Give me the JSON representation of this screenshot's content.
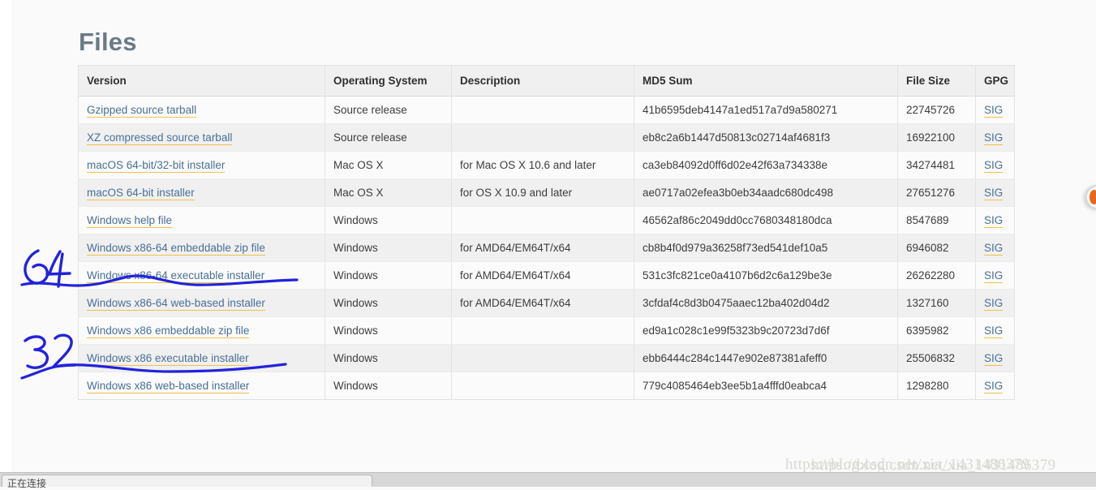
{
  "page": {
    "title": "Files",
    "background_color": "#fafafa",
    "link_color": "#4a6f96",
    "link_underline_color": "#f2c14a",
    "title_color": "#6b7a86"
  },
  "table": {
    "headers": [
      "Version",
      "Operating System",
      "Description",
      "MD5 Sum",
      "File Size",
      "GPG"
    ],
    "rows": [
      {
        "version": "Gzipped source tarball",
        "os": "Source release",
        "description": "",
        "md5": "41b6595deb4147a1ed517a7d9a580271",
        "size": "22745726",
        "gpg": "SIG"
      },
      {
        "version": "XZ compressed source tarball",
        "os": "Source release",
        "description": "",
        "md5": "eb8c2a6b1447d50813c02714af4681f3",
        "size": "16922100",
        "gpg": "SIG"
      },
      {
        "version": "macOS 64-bit/32-bit installer",
        "os": "Mac OS X",
        "description": "for Mac OS X 10.6 and later",
        "md5": "ca3eb84092d0ff6d02e42f63a734338e",
        "size": "34274481",
        "gpg": "SIG"
      },
      {
        "version": "macOS 64-bit installer",
        "os": "Mac OS X",
        "description": "for OS X 10.9 and later",
        "md5": "ae0717a02efea3b0eb34aadc680dc498",
        "size": "27651276",
        "gpg": "SIG"
      },
      {
        "version": "Windows help file",
        "os": "Windows",
        "description": "",
        "md5": "46562af86c2049dd0cc7680348180dca",
        "size": "8547689",
        "gpg": "SIG"
      },
      {
        "version": "Windows x86-64 embeddable zip file",
        "os": "Windows",
        "description": "for AMD64/EM64T/x64",
        "md5": "cb8b4f0d979a36258f73ed541def10a5",
        "size": "6946082",
        "gpg": "SIG"
      },
      {
        "version": "Windows x86-64 executable installer",
        "os": "Windows",
        "description": "for AMD64/EM64T/x64",
        "md5": "531c3fc821ce0a4107b6d2c6a129be3e",
        "size": "26262280",
        "gpg": "SIG"
      },
      {
        "version": "Windows x86-64 web-based installer",
        "os": "Windows",
        "description": "for AMD64/EM64T/x64",
        "md5": "3cfdaf4c8d3b0475aaec12ba402d04d2",
        "size": "1327160",
        "gpg": "SIG"
      },
      {
        "version": "Windows x86 embeddable zip file",
        "os": "Windows",
        "description": "",
        "md5": "ed9a1c028c1e99f5323b9c20723d7d6f",
        "size": "6395982",
        "gpg": "SIG"
      },
      {
        "version": "Windows x86 executable installer",
        "os": "Windows",
        "description": "",
        "md5": "ebb6444c284c1447e902e87381afeff0",
        "size": "25506832",
        "gpg": "SIG"
      },
      {
        "version": "Windows x86 web-based installer",
        "os": "Windows",
        "description": "",
        "md5": "779c4085464eb3ee5b1a4fffd0eabca4",
        "size": "1298280",
        "gpg": "SIG"
      }
    ]
  },
  "annotations": {
    "color": "#2222dd",
    "marks": [
      {
        "label": "64",
        "target_row": "Windows x86-64 executable installer"
      },
      {
        "label": "32",
        "target_row": "Windows x86 executable installer"
      }
    ]
  },
  "watermark": {
    "line_a": "https://blog.csdn.net/xia_1431486379",
    "line_b": "https://blog.csdn.net/xia_1431486379",
    "color": "#d8d8d4"
  },
  "status_bar": {
    "text": "正在连接"
  },
  "edge_icon": {
    "name": "orange-circle-icon",
    "color": "#e8661a"
  }
}
